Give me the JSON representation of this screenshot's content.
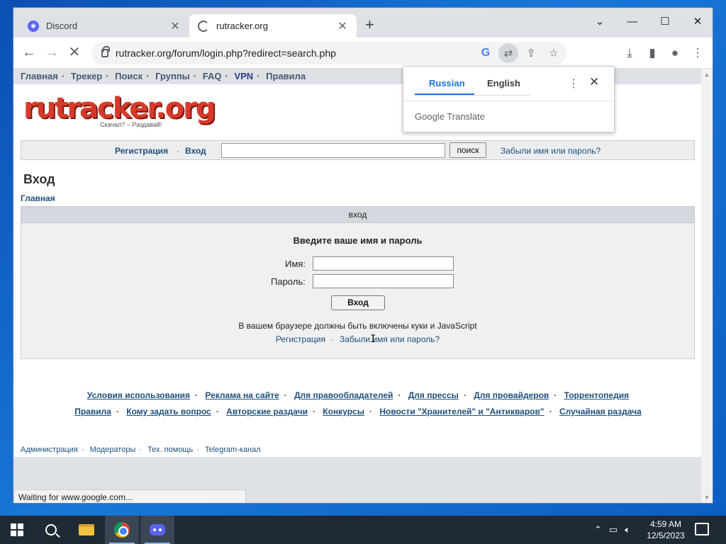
{
  "browser": {
    "tabs": [
      {
        "title": "Discord",
        "icon": "discord-icon"
      },
      {
        "title": "rutracker.org",
        "icon": "loading-icon"
      }
    ],
    "url": "rutracker.org/forum/login.php?redirect=search.php",
    "status": "Waiting for www.google.com..."
  },
  "translate_popup": {
    "languages": [
      "Russian",
      "English"
    ],
    "selected": "Russian",
    "brand": "Google Translate"
  },
  "page": {
    "topnav": [
      "Главная",
      "Трекер",
      "Поиск",
      "Группы",
      "FAQ",
      "VPN",
      "Правила"
    ],
    "logo": {
      "text": "rutracker.org",
      "slogan": "Скачал? – Раздавай!"
    },
    "searchbar": {
      "register": "Регистрация",
      "login": "Вход",
      "search_button": "поиск",
      "forgot": "Забыли имя или пароль?"
    },
    "heading": "Вход",
    "breadcrumb": "Главная",
    "login_box": {
      "header": "вход",
      "prompt": "Введите ваше имя и пароль",
      "name_label": "Имя:",
      "password_label": "Пароль:",
      "name_value": "",
      "password_value": "",
      "submit": "Вход",
      "note": "В вашем браузере должны быть включены куки и JavaScript",
      "register_link": "Регистрация",
      "forgot_link": "Забыли имя или пароль?"
    },
    "footer_row1": [
      "Условия использования",
      "Реклама на сайте",
      "Для правообладателей",
      "Для прессы",
      "Для провайдеров",
      "Торрентопедия"
    ],
    "footer_row2": [
      "Правила",
      "Кому задать вопрос",
      "Авторские раздачи",
      "Конкурсы",
      "Новости \"Хранителей\" и \"Антикваров\"",
      "Случайная раздача"
    ],
    "admin_links": [
      "Администрация",
      "Модераторы",
      "Тех. помощь",
      "Telegram-канал"
    ]
  },
  "taskbar": {
    "time": "4:59 AM",
    "date": "12/5/2023",
    "apps": [
      "start",
      "search",
      "file-explorer",
      "chrome",
      "discord"
    ]
  }
}
